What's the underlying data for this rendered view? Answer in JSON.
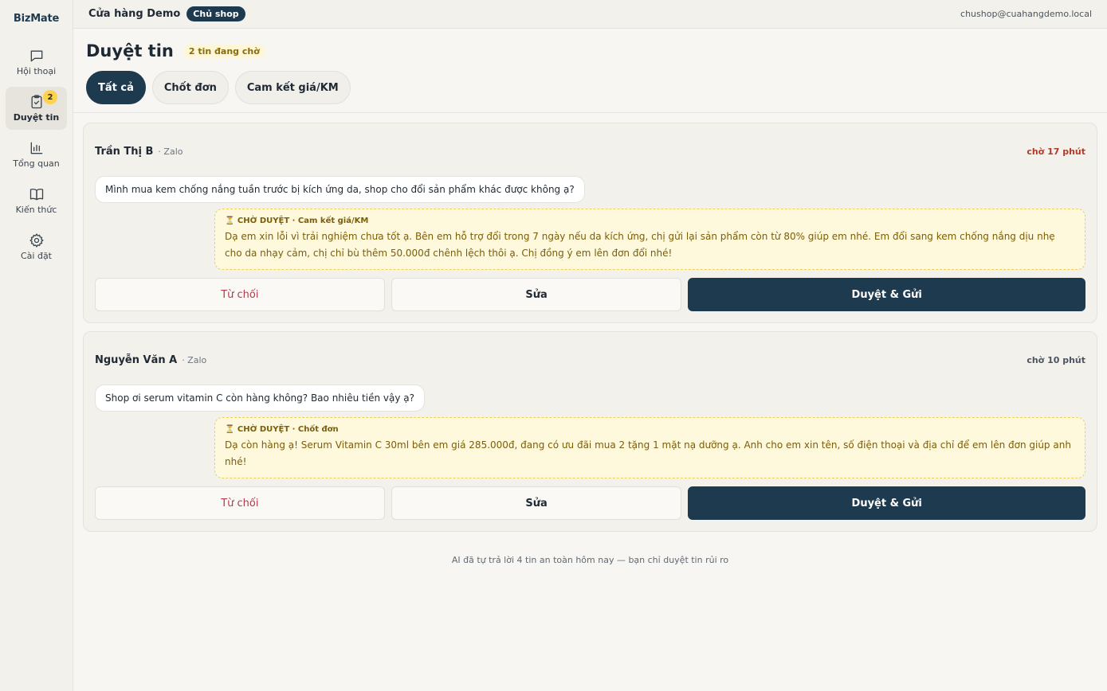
{
  "brand": "BizMate",
  "sidebar": {
    "items": [
      {
        "label": "Hội thoại",
        "icon": "chat-icon"
      },
      {
        "label": "Duyệt tin",
        "icon": "clipboard-check-icon",
        "badge": "2",
        "active": true
      },
      {
        "label": "Tổng quan",
        "icon": "bar-chart-icon"
      },
      {
        "label": "Kiến thức",
        "icon": "book-icon"
      },
      {
        "label": "Cài đặt",
        "icon": "gear-icon"
      }
    ]
  },
  "topbar": {
    "shop_name": "Cửa hàng Demo",
    "role": "Chủ shop",
    "email": "chushop@cuahangdemo.local"
  },
  "page": {
    "title": "Duyệt tin",
    "pending": "2 tin đang chờ"
  },
  "tabs": [
    {
      "label": "Tất cả",
      "active": true
    },
    {
      "label": "Chốt đơn"
    },
    {
      "label": "Cam kết giá/KM"
    }
  ],
  "cards": [
    {
      "customer": "Trần Thị B",
      "channel": "· Zalo",
      "wait": "chờ 17 phút",
      "message": "Mình mua kem chống nắng tuần trước bị kích ứng da, shop cho đổi sản phẩm khác được không ạ?",
      "draft_tag": "⏳ CHỜ DUYỆT · Cam kết giá/KM",
      "draft_text": "Dạ em xin lỗi vì trải nghiệm chưa tốt ạ. Bên em hỗ trợ đổi trong 7 ngày nếu da kích ứng, chị gửi lại sản phẩm còn từ 80% giúp em nhé. Em đổi sang kem chống nắng dịu nhẹ cho da nhạy cảm, chị chỉ bù thêm 50.000đ chênh lệch thôi ạ. Chị đồng ý em lên đơn đổi nhé!",
      "reject": "Từ chối",
      "edit": "Sửa",
      "approve": "Duyệt & Gửi"
    },
    {
      "customer": "Nguyễn Văn A",
      "channel": "· Zalo",
      "wait": "chờ 10 phút",
      "message": "Shop ơi serum vitamin C còn hàng không? Bao nhiêu tiền vậy ạ?",
      "draft_tag": "⏳ CHỜ DUYỆT · Chốt đơn",
      "draft_text": "Dạ còn hàng ạ! Serum Vitamin C 30ml bên em giá 285.000đ, đang có ưu đãi mua 2 tặng 1 mặt nạ dưỡng ạ. Anh cho em xin tên, số điện thoại và địa chỉ để em lên đơn giúp anh nhé!",
      "reject": "Từ chối",
      "edit": "Sửa",
      "approve": "Duyệt & Gửi"
    }
  ],
  "footer": "AI đã tự trả lời 4 tin an toàn hôm nay — bạn chỉ duyệt tin rủi ro"
}
